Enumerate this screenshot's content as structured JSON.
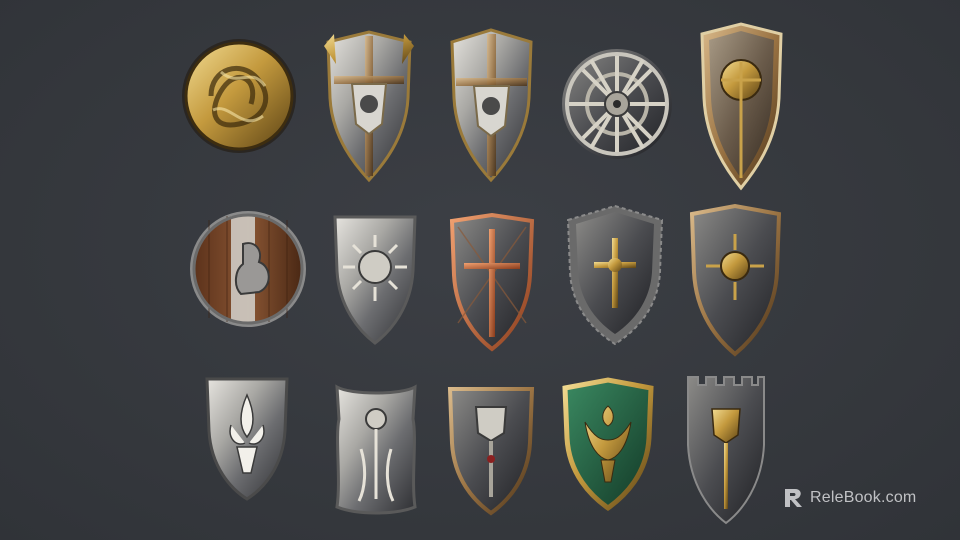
{
  "scene": {
    "background": "#373a40",
    "metal_light": "#d9d7d2",
    "metal_dark": "#4a4b4f",
    "gold": "#c9a24a",
    "bronze": "#a07840",
    "wood": "#7a4a2c",
    "green_enamel": "#1f5a3c"
  },
  "shields": [
    {
      "row": 1,
      "emblem": "gold-knotwork-dragon",
      "shape": "round"
    },
    {
      "row": 1,
      "emblem": "winged-eagle-crest",
      "shape": "kite"
    },
    {
      "row": 1,
      "emblem": "cross-eagle-crest",
      "shape": "kite"
    },
    {
      "row": 1,
      "emblem": "wheel-sunburst",
      "shape": "round"
    },
    {
      "row": 1,
      "emblem": "ornate-gold-medallion",
      "shape": "tall-kite"
    },
    {
      "row": 2,
      "emblem": "rooster",
      "shape": "round-wood"
    },
    {
      "row": 2,
      "emblem": "sun",
      "shape": "heater"
    },
    {
      "row": 2,
      "emblem": "copper-cross-lattice",
      "shape": "heater"
    },
    {
      "row": 2,
      "emblem": "gold-cross",
      "shape": "spiked-heater"
    },
    {
      "row": 2,
      "emblem": "gold-rosette",
      "shape": "heater"
    },
    {
      "row": 3,
      "emblem": "fleur-de-lis",
      "shape": "heater"
    },
    {
      "row": 3,
      "emblem": "tree-of-life",
      "shape": "notched"
    },
    {
      "row": 3,
      "emblem": "heraldic-crest",
      "shape": "heater"
    },
    {
      "row": 3,
      "emblem": "eagle",
      "shape": "green-heater"
    },
    {
      "row": 3,
      "emblem": "castle-crest",
      "shape": "crenellated"
    }
  ],
  "watermark": {
    "icon": "relebook-logo-icon",
    "text": "ReleBook.com"
  }
}
